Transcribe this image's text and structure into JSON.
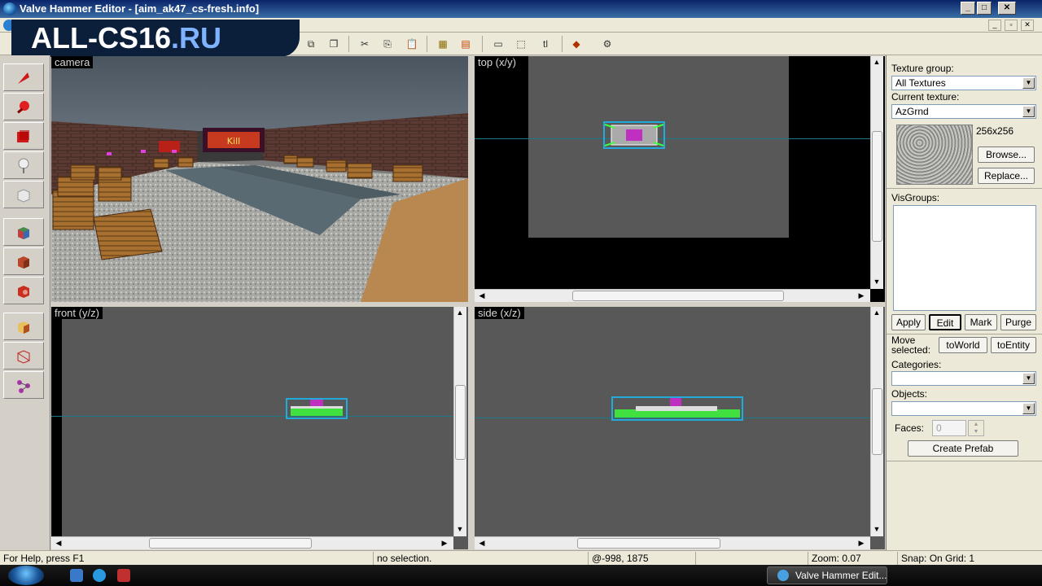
{
  "window": {
    "title": "Valve Hammer Editor - [aim_ak47_cs-fresh.info]",
    "min": "_",
    "max": "□",
    "close": "✕"
  },
  "watermark": {
    "main": "ALL-CS16",
    "suffix": ".RU"
  },
  "viewports": {
    "camera": "camera",
    "top": "top (x/y)",
    "front": "front (y/z)",
    "side": "side (x/z)"
  },
  "camera_sign": "Kill",
  "panel": {
    "texture_group_label": "Texture group:",
    "texture_group_value": "All Textures",
    "current_texture_label": "Current texture:",
    "current_texture_value": "AzGrnd",
    "texture_size": "256x256",
    "browse": "Browse...",
    "replace": "Replace...",
    "visgroups_label": "VisGroups:",
    "apply": "Apply",
    "edit": "Edit",
    "mark": "Mark",
    "purge": "Purge",
    "move_selected_1": "Move",
    "move_selected_2": "selected:",
    "to_world": "toWorld",
    "to_entity": "toEntity",
    "categories_label": "Categories:",
    "objects_label": "Objects:",
    "faces_label": "Faces:",
    "faces_value": "0",
    "create_prefab": "Create Prefab"
  },
  "status": {
    "help": "For Help, press F1",
    "selection": "no selection.",
    "coords": "@-998, 1875",
    "zoom": "Zoom: 0.07",
    "snap": "Snap: On Grid: 1"
  },
  "taskbar": {
    "task": "Valve Hammer Edit..."
  },
  "colors": {
    "viewport_bg": "#585858",
    "accent": "#0a246a"
  }
}
